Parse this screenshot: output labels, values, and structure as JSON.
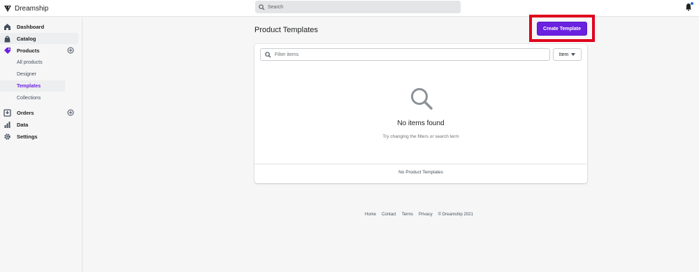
{
  "brand": {
    "name": "Dreamship"
  },
  "search": {
    "placeholder": "Search"
  },
  "sidebar": {
    "items": [
      {
        "label": "Dashboard"
      },
      {
        "label": "Catalog"
      },
      {
        "label": "Products"
      },
      {
        "label": "Orders"
      },
      {
        "label": "Data"
      },
      {
        "label": "Settings"
      }
    ],
    "products_sub": [
      {
        "label": "All products"
      },
      {
        "label": "Designer"
      },
      {
        "label": "Templates"
      },
      {
        "label": "Collections"
      }
    ]
  },
  "main": {
    "title": "Product Templates",
    "create_button": "Create Template",
    "filter_placeholder": "Filter items",
    "item_dropdown": "Item",
    "empty_title": "No items found",
    "empty_subtitle": "Try changing the filters or search term",
    "card_footer": "No Product Templates"
  },
  "footer": {
    "links": [
      "Home",
      "Contact",
      "Terms",
      "Privacy"
    ],
    "copyright": "© Dreamship 2021"
  },
  "colors": {
    "accent": "#6b21e0",
    "highlight": "#e0001b"
  },
  "icons": [
    "logo-icon",
    "search-icon",
    "bell-icon",
    "dashboard-icon",
    "catalog-icon",
    "products-icon",
    "orders-icon",
    "data-icon",
    "settings-icon",
    "plus-circle-icon",
    "filter-search-icon",
    "caret-down-icon",
    "empty-search-icon"
  ]
}
